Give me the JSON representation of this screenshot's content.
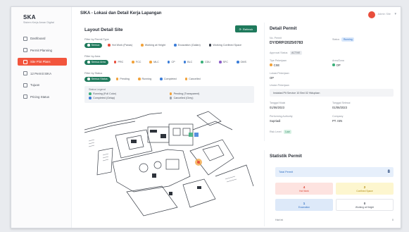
{
  "sidebar": {
    "brand": "SKA",
    "brand_sub": "Sistem Kerja Aman Digital",
    "items": [
      {
        "label": "Dashboard",
        "icon": "grid-icon",
        "active": false
      },
      {
        "label": "Permit Planning",
        "icon": "calendar-icon",
        "active": false
      },
      {
        "label": "Site Plot Plans",
        "icon": "map-icon",
        "active": true
      },
      {
        "label": "12 Permit SIKA",
        "icon": "file-icon",
        "active": false
      },
      {
        "label": "Tujuan",
        "icon": "target-icon",
        "active": false
      },
      {
        "label": "Pricing Status",
        "icon": "settings-icon",
        "active": false
      }
    ]
  },
  "topbar": {
    "title": "SIKA - Lokasi dan Detail Kerja Lapangan",
    "user": "Admin Site"
  },
  "layout": {
    "title": "Layout Detail Site",
    "refresh_label": "Refresh",
    "filter_permit_type": {
      "label": "Filter by Permit Type",
      "chips": [
        {
          "label": "Semua",
          "color": "#1f7a5c",
          "selected": true
        },
        {
          "label": "Hot Work (Panas)",
          "color": "#e94e3c",
          "selected": false
        },
        {
          "label": "Working at Height",
          "color": "#f2a23a",
          "selected": false
        },
        {
          "label": "Excavation (Galian)",
          "color": "#3b7dd8",
          "selected": false
        },
        {
          "label": "Working Confined Space",
          "color": "#333a45",
          "selected": false
        }
      ]
    },
    "filter_area": {
      "label": "Filter by Area",
      "chips": [
        {
          "label": "Semua Area",
          "color": "#1f7a5c",
          "selected": true
        },
        {
          "label": "PRC",
          "color": "#e94e3c",
          "selected": false
        },
        {
          "label": "FCC",
          "color": "#f2a23a",
          "selected": false
        },
        {
          "label": "MLC",
          "color": "#f2a23a",
          "selected": false
        },
        {
          "label": "CP",
          "color": "#3b7dd8",
          "selected": false
        },
        {
          "label": "BLC",
          "color": "#3b7dd8",
          "selected": false
        },
        {
          "label": "CDU",
          "color": "#3bb07a",
          "selected": false
        },
        {
          "label": "SFC",
          "color": "#8b5cc7",
          "selected": false
        },
        {
          "label": "OMS",
          "color": "#3b7dd8",
          "selected": false
        }
      ]
    },
    "filter_status": {
      "label": "Filter by Status",
      "chips": [
        {
          "label": "Semua Status",
          "color": "#1f7a5c",
          "selected": true
        },
        {
          "label": "Pending",
          "color": "#f2a23a",
          "selected": false
        },
        {
          "label": "Running",
          "color": "#f2a23a",
          "selected": false
        },
        {
          "label": "Completed",
          "color": "#3b7dd8",
          "selected": false
        },
        {
          "label": "Cancelled",
          "color": "#f2a23a",
          "selected": false
        }
      ]
    },
    "legend": {
      "title": "Status Legend",
      "items": [
        {
          "label": "Running (Full Color)",
          "color": "#3bb07a"
        },
        {
          "label": "Pending (Transparent)",
          "color": "#f2a23a"
        },
        {
          "label": "Completed (Gelap)",
          "color": "#3b7dd8"
        },
        {
          "label": "Cancelled (Grey)",
          "color": "#9aa0aa"
        }
      ]
    }
  },
  "detail": {
    "title": "Detail Permit",
    "no_permit_label": "No. Permit",
    "no_permit_value": "DY/DRP/2025/0783",
    "status_label": "Status",
    "status_value": "Running",
    "approval_label": "Approval Status",
    "approval_value": "ACTIVE",
    "jenis_label": "Tipe Pekerjaan",
    "jenis_value": "CSE",
    "jenis_color": "#f2a23a",
    "area_label": "Area/Zona",
    "area_value": "OP",
    "area_color": "#3bb07a",
    "lokasi_label": "Lokasi Pekerjaan",
    "lokasi_value": "OP",
    "uraian_label": "Uraian Pekerjaan",
    "uraian_value": "Instalasi Pit Service 10 Bmi 02 Hidupkan",
    "mulai_label": "Tanggal Mulai",
    "mulai_value": "01/06/2023",
    "selesai_label": "Tanggal Selesai",
    "selesai_value": "01/06/2023",
    "pemohon_label": "Performing Authority",
    "pemohon_value": "Supriadi",
    "perusahaan_label": "Company",
    "perusahaan_value": "PT. ISN",
    "risk_label": "Risk Level",
    "risk_value": "Low"
  },
  "stats": {
    "title": "Statistik Permit",
    "total_label": "Total Permit",
    "total_value": "8",
    "tiles": [
      {
        "value": "4",
        "label": "Hot Work",
        "bg": "#fde3e0",
        "fg": "#d9412f"
      },
      {
        "value": "2",
        "label": "Confined Space",
        "bg": "#fdf6cf",
        "fg": "#b08a10"
      },
      {
        "value": "1",
        "label": "Excavation",
        "bg": "#dde9f9",
        "fg": "#2f6fc4"
      },
      {
        "value": "0",
        "label": "Working at Height",
        "bg": "#ffffff",
        "fg": "#4a505a"
      }
    ],
    "footer_label": "Hari ini",
    "footer_value": "0"
  }
}
